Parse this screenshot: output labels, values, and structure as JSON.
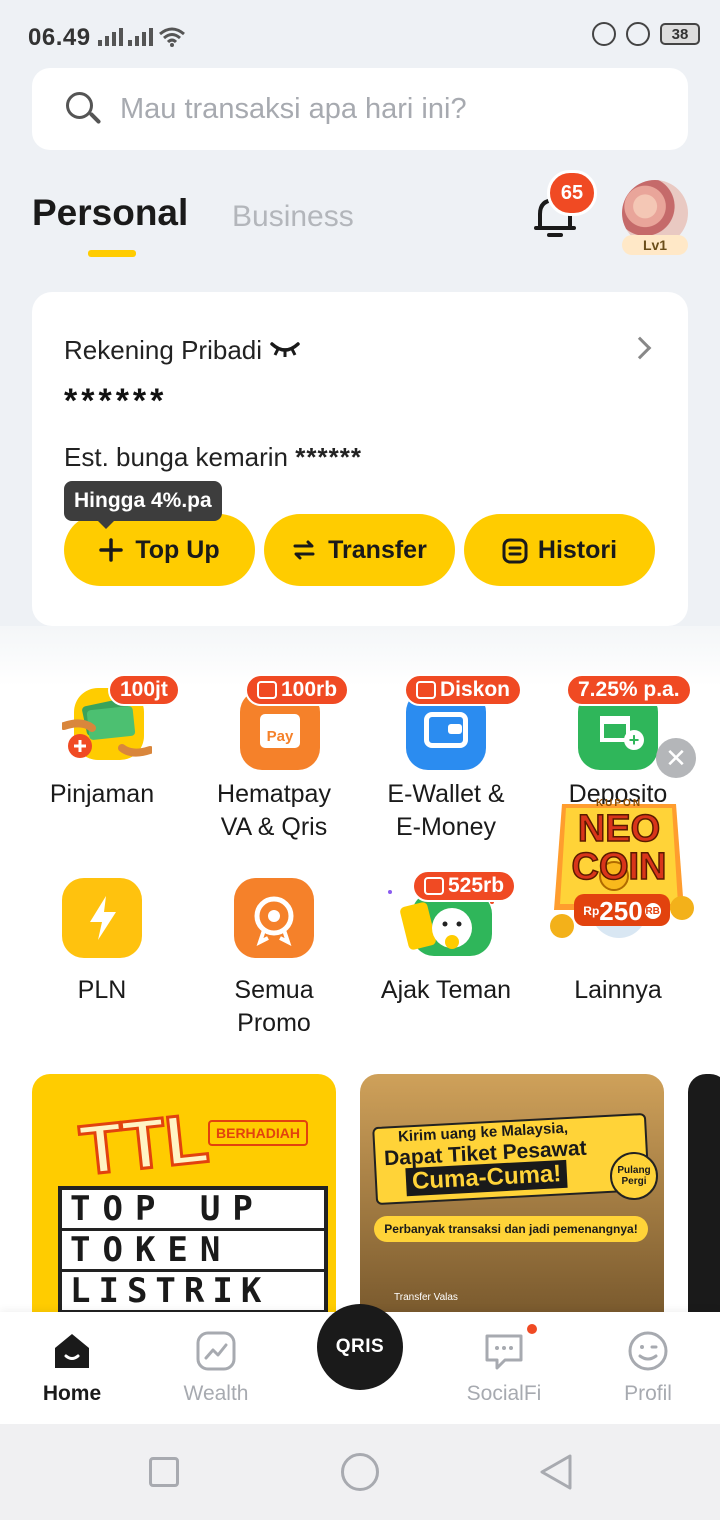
{
  "status_bar": {
    "time": "06.49",
    "battery": "38"
  },
  "search": {
    "placeholder": "Mau transaksi apa hari ini?"
  },
  "tabs": {
    "personal": "Personal",
    "business": "Business"
  },
  "notifications": {
    "count": "65"
  },
  "profile": {
    "level": "Lv1"
  },
  "account": {
    "title": "Rekening Pribadi",
    "balance": "******",
    "interest_label": "Est. bunga kemarin",
    "interest_value": "******",
    "tooltip": "Hingga 4%.pa",
    "buttons": {
      "topup": "Top Up",
      "transfer": "Transfer",
      "history": "Histori"
    }
  },
  "menu": {
    "row1": [
      {
        "label": "Pinjaman",
        "tag": "100jt"
      },
      {
        "label1": "Hematpay",
        "label2": "VA & Qris",
        "tag": "100rb",
        "tile_text": "Pay"
      },
      {
        "label1": "E-Wallet &",
        "label2": "E-Money",
        "tag": "Diskon"
      },
      {
        "label": "Deposito",
        "tag": "7.25% p.a."
      }
    ],
    "row2": [
      {
        "label": "PLN"
      },
      {
        "label1": "Semua",
        "label2": "Promo"
      },
      {
        "label": "Ajak Teman",
        "tag": "525rb"
      },
      {
        "label": "Lainnya"
      }
    ]
  },
  "floating_promo": {
    "kupon": "KUPON",
    "line1": "NEO",
    "line2": "COIN",
    "currency": "Rp",
    "amount": "250",
    "unit": "RB"
  },
  "banners": [
    {
      "logo": "TTL",
      "badge": "BERHADIAH",
      "words": [
        "TOP UP",
        "TOKEN",
        "LISTRIK"
      ]
    },
    {
      "line1": "Kirim uang ke",
      "country": "Malaysia,",
      "line2": "Dapat Tiket Pesawat",
      "line3": "Cuma-Cuma!",
      "badge": "Pulang Pergi",
      "note": "Perbanyak transaksi dan jadi pemenangnya!",
      "small": "Transfer Valas"
    }
  ],
  "bottom_nav": {
    "home": "Home",
    "wealth": "Wealth",
    "qris": "QRIS",
    "socialfi": "SocialFi",
    "profile": "Profil"
  },
  "colors": {
    "accent": "#ffcc00",
    "badge": "#f04a23",
    "dark": "#1a1a1a"
  }
}
